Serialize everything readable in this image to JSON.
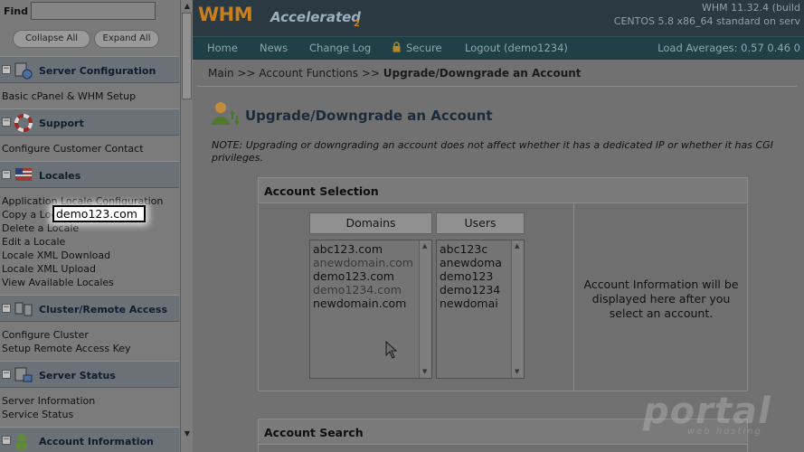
{
  "sidebar": {
    "find_label": "Find",
    "find_value": "",
    "collapse_all": "Collapse All",
    "expand_all": "Expand All",
    "sections": [
      {
        "title": "Server Configuration",
        "icon": "server-config-icon",
        "links": [
          "Basic cPanel & WHM Setup"
        ]
      },
      {
        "title": "Support",
        "icon": "lifebuoy-icon",
        "links": [
          "Configure Customer Contact"
        ]
      },
      {
        "title": "Locales",
        "icon": "flag-icon",
        "links": [
          "Application Locale Configuration",
          "Copy a Locale",
          "Delete a Locale",
          "Edit a Locale",
          "Locale XML Download",
          "Locale XML Upload",
          "View Available Locales"
        ]
      },
      {
        "title": "Cluster/Remote Access",
        "icon": "cluster-icon",
        "links": [
          "Configure Cluster",
          "Setup Remote Access Key"
        ]
      },
      {
        "title": "Server Status",
        "icon": "server-status-icon",
        "links": [
          "Server Information",
          "Service Status"
        ]
      },
      {
        "title": "Account Information",
        "icon": "account-info-icon",
        "links": []
      }
    ]
  },
  "header": {
    "logo_main": "WHM",
    "logo_accent": "Accelerated",
    "logo_sub": "2",
    "version": "WHM 11.32.4 (build",
    "os": "CENTOS 5.8 x86_64 standard on serv"
  },
  "nav": {
    "items": [
      "Home",
      "News",
      "Change Log",
      "Secure",
      "Logout (demo1234)"
    ],
    "load_averages": "Load Averages: 0.57 0.46 0"
  },
  "breadcrumb": {
    "main": "Main",
    "sep": ">>",
    "section": "Account Functions",
    "current": "Upgrade/Downgrade an Account"
  },
  "page": {
    "title": "Upgrade/Downgrade an Account",
    "note": "NOTE: Upgrading or downgrading an account does not affect whether it has a dedicated IP or whether it has CGI privileges."
  },
  "account_selection": {
    "title": "Account Selection",
    "domains_header": "Domains",
    "users_header": "Users",
    "domains": [
      "abc123.com",
      "anewdomain.com",
      "demo123.com",
      "demo1234.com",
      "newdomain.com"
    ],
    "users": [
      "abc123c",
      "anewdoma",
      "demo123",
      "demo1234",
      "newdomai"
    ],
    "highlighted_domain": "demo123.com",
    "info_text": "Account Information will be displayed here after you select an account."
  },
  "account_search": {
    "title": "Account Search"
  },
  "watermark": {
    "main": "portal",
    "sub": "web hosting"
  }
}
